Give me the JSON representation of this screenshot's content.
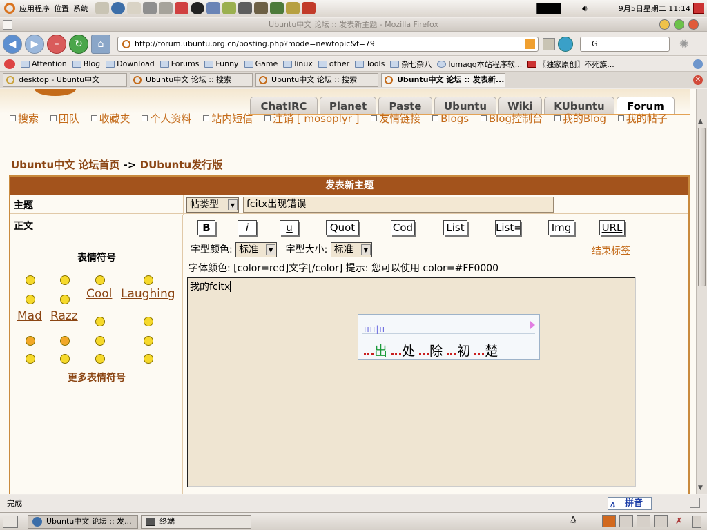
{
  "top_panel": {
    "menus": [
      "应用程序",
      "位置",
      "系统"
    ],
    "clock": "9月5日星期二 11:14"
  },
  "window": {
    "title": "Ubuntu中文 论坛 :: 发表新主题 - Mozilla Firefox"
  },
  "navbar": {
    "url": "http://forum.ubuntu.org.cn/posting.php?mode=newtopic&f=79",
    "search_value": "G"
  },
  "bookmarks": [
    "Attention",
    "Blog",
    "Download",
    "Forums",
    "Funny",
    "Game",
    "linux",
    "other",
    "Tools",
    "杂七杂八",
    "lumaqq本站程序软...",
    "〖独家原创〗不死族..."
  ],
  "tabs": [
    {
      "label": "desktop - Ubuntu中文"
    },
    {
      "label": "Ubuntu中文 论坛 :: 搜索"
    },
    {
      "label": "Ubuntu中文 论坛 :: 搜索"
    },
    {
      "label": "Ubuntu中文 论坛 :: 发表新..."
    }
  ],
  "site_tabs": [
    "ChatIRC",
    "Planet",
    "Paste",
    "Ubuntu",
    "Wiki",
    "KUbuntu",
    "Forum"
  ],
  "forum_links": [
    "搜索",
    "团队",
    "收藏夹",
    "个人资料",
    "站内短信",
    "注销 [ mosoplyr ]",
    "友情链接",
    "Blogs",
    "Blog控制台",
    "我的Blog",
    "我的帖子"
  ],
  "breadcrumb": {
    "home": "Ubuntu中文 论坛首页",
    "sep": "->",
    "forum": "DUbuntu发行版"
  },
  "post_form": {
    "header": "发表新主题",
    "subject_label": "主题",
    "type_select": "帖类型",
    "subject_value": "fcitx出现错误",
    "body_label": "正文",
    "format_buttons": [
      "B",
      "i",
      "u",
      "Quot",
      "Cod",
      "List",
      "List=",
      "Img",
      "URL"
    ],
    "font_color_label": "字型颜色:",
    "font_color_value": "标准",
    "font_size_label": "字型大小:",
    "font_size_value": "标准",
    "close_tags": "结束标签",
    "color_hint": "字体颜色: [color=red]文字[/color]  提示: 您可以使用 color=#FF0000",
    "body_value": "我的fcitx"
  },
  "ime_popup": {
    "input_marks": "ıııı|ıı",
    "candidates": [
      "出",
      "处",
      "除",
      "初",
      "楚"
    ]
  },
  "emoticons": {
    "title": "表情符号",
    "words": [
      "Cool",
      "Laughing",
      "Mad",
      "Razz"
    ],
    "more": "更多表情符号"
  },
  "status": {
    "text": "完成",
    "ime_mode": "拼音"
  },
  "taskbar": [
    {
      "label": "Ubuntu中文 论坛 :: 发..."
    },
    {
      "label": "终端"
    }
  ]
}
